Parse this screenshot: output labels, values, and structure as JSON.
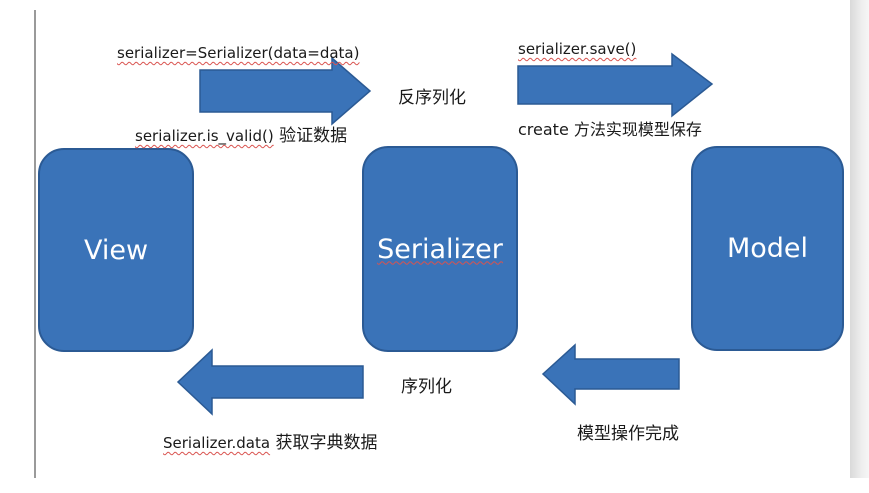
{
  "colors": {
    "box_fill": "#3a73b8",
    "box_border": "#2b5a94",
    "arrow_fill": "#3a73b8",
    "spell_underline": "#d9534f"
  },
  "boxes": {
    "view": "View",
    "serializer": "Serializer",
    "model": "Model"
  },
  "labels": {
    "top_left_code": "serializer=Serializer(data=data)",
    "is_valid_code": "serializer.is_valid()",
    "is_valid_text": " 验证数据",
    "deserialize": "反序列化",
    "save_code": "serializer.save()",
    "create_text": "create 方法实现模型保存",
    "serialize": "序列化",
    "data_code": "Serializer.data",
    "data_text": " 获取字典数据",
    "model_done": "模型操作完成"
  }
}
